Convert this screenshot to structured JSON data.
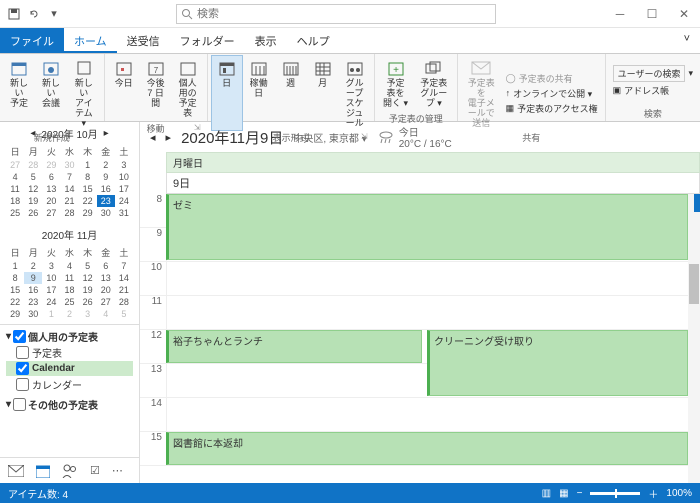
{
  "search": {
    "placeholder": "検索"
  },
  "tabs": {
    "file": "ファイル",
    "home": "ホーム",
    "sendrecv": "送受信",
    "folder": "フォルダー",
    "view": "表示",
    "help": "ヘルプ"
  },
  "ribbon": {
    "new_appt": "新しい\n予定",
    "new_meet": "新しい\n会議",
    "new_item": "新しい\nアイテム ▾",
    "grp_new": "新規作成",
    "today": "今日",
    "next7": "今後\n7 日間",
    "personal_sched": "個人用の\n予定表",
    "grp_goto": "移動",
    "day": "日",
    "workweek": "稼働日",
    "week": "週",
    "month": "月",
    "grpsched": "グループ\nスケジュール",
    "grp_view": "表示形式",
    "open_sched": "予定表を\n開く ▾",
    "sched_group": "予定表\nグループ ▾",
    "grp_manage": "予定表の管理",
    "fwd": "予定表を\n電子メールで送信",
    "share_sched": "予定表の共有",
    "online": "オンラインで公開 ▾",
    "perm": "予定表のアクセス権",
    "grp_share": "共有",
    "search_user": "ユーザーの検索",
    "addr": "アドレス帳",
    "grp_search": "検索"
  },
  "minicals": {
    "month1": "2020年 10月",
    "month2": "2020年 11月",
    "dow": [
      "日",
      "月",
      "火",
      "水",
      "木",
      "金",
      "土"
    ]
  },
  "sidecal": {
    "personal_hdr": "個人用の予定表",
    "items": [
      "予定表",
      "Calendar",
      "カレンダー"
    ],
    "other_hdr": "その他の予定表"
  },
  "header": {
    "date": "2020年11月9日",
    "location": "中央区, 東京都 ▾",
    "weather_label": "今日",
    "weather_temp": "20°C / 16°C"
  },
  "dayname": "月曜日",
  "daynum": "9日",
  "hours": [
    "8",
    "9",
    "10",
    "11",
    "12",
    "13",
    "14",
    "15"
  ],
  "events": {
    "semi": "ゼミ",
    "lunch": "裕子ちゃんとランチ",
    "clean": "クリーニング受け取り",
    "library": "図書館に本返却"
  },
  "status": {
    "items": "アイテム数: 4",
    "zoom": "100%"
  }
}
